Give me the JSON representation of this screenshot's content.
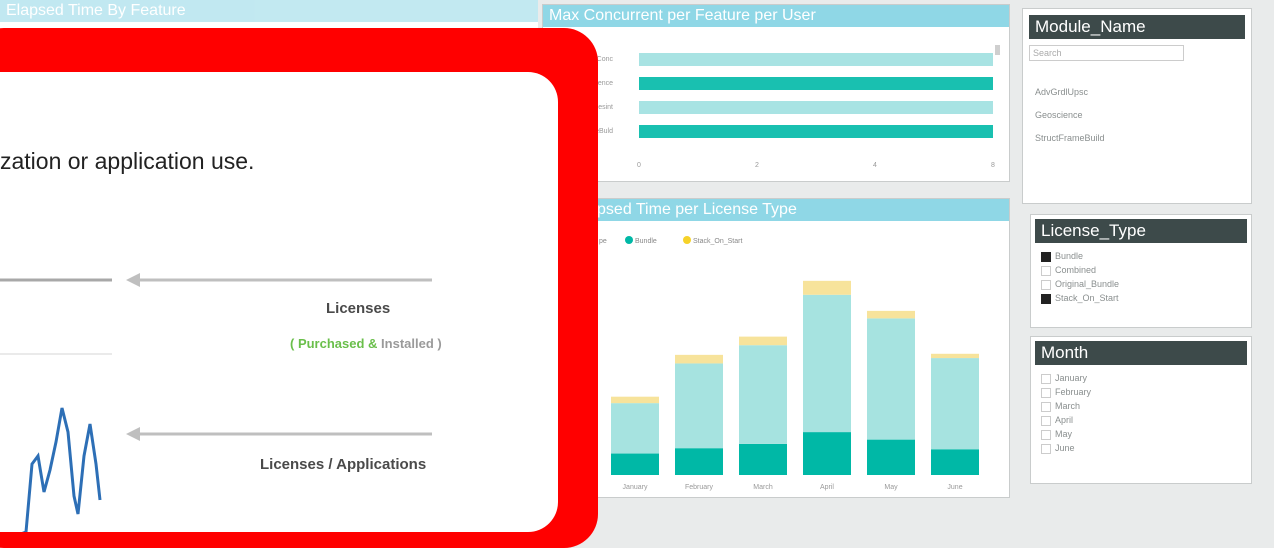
{
  "top_left_panel": {
    "title": "Elapsed Time By Feature"
  },
  "bar_panel": {
    "title": "Max Concurrent per Feature per User",
    "categories": [
      "AdvGrdlComs",
      "Geoscience",
      "StructSesInt",
      "StructFrameBuild"
    ],
    "category_labels": [
      "nConc",
      "icence",
      "Sesint",
      "meBuld"
    ],
    "values": [
      8,
      8,
      8,
      8
    ],
    "series_colors": [
      "#a8e3e3",
      "#19c0b0",
      "#a8e3e3",
      "#19c0b0"
    ],
    "xticks": [
      "0",
      "2",
      "4",
      "8"
    ]
  },
  "stack_panel": {
    "title": "les Elapsed Time per License Type",
    "legend_prefix": "pe",
    "legend": [
      {
        "name": "Bundle",
        "color": "#00b8a6"
      },
      {
        "name": "Stack_On_Start",
        "color": "#f6d229"
      }
    ],
    "months": [
      "January",
      "February",
      "March",
      "April",
      "May",
      "June"
    ],
    "bundle": [
      20,
      25,
      29,
      40,
      33,
      24
    ],
    "combined": [
      47,
      79,
      92,
      128,
      113,
      85
    ],
    "stack": [
      6,
      8,
      8,
      13,
      7,
      4
    ],
    "ymax": 220
  },
  "slicers": {
    "module": {
      "title": "Module_Name",
      "search_placeholder": "Search",
      "items": [
        "AdvGrdlUpsc",
        "Geoscience",
        "StructFrameBuild"
      ]
    },
    "license": {
      "title": "License_Type",
      "items": [
        {
          "label": "Bundle",
          "checked": true
        },
        {
          "label": "Combined",
          "checked": false
        },
        {
          "label": "Original_Bundle",
          "checked": false
        },
        {
          "label": "Stack_On_Start",
          "checked": true
        }
      ]
    },
    "month": {
      "title": "Month",
      "items": [
        "January",
        "February",
        "March",
        "April",
        "May",
        "June"
      ]
    }
  },
  "overlay": {
    "sentence": "zation or application use.",
    "licenses_label": "Licenses",
    "purchased": "( Purchased &",
    "installed": "Installed )",
    "apps_label": "Licenses / Applications",
    "colors": {
      "purchased": "#6abf4b",
      "installed": "#9a9a9a",
      "line": "#2d6fb6",
      "frame": "#ff0000"
    }
  }
}
